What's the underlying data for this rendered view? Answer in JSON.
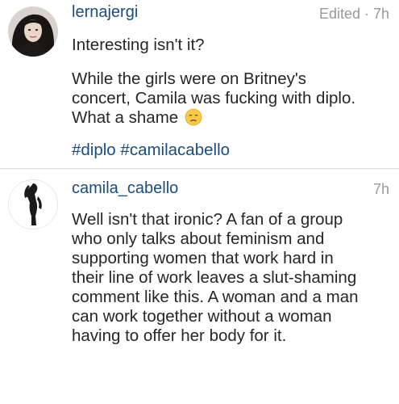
{
  "comments": [
    {
      "username": "lernajergi",
      "meta": "Edited · 7h",
      "paragraph_1": "Interesting isn't it?",
      "paragraph_2_lines": [
        "While the girls were on Britney's",
        "concert, Camila was fucking with diplo.",
        "What a shame"
      ],
      "emoji": "disappointed-face-icon",
      "hashtags": [
        "#diplo",
        "#camilacabello"
      ]
    },
    {
      "username": "camila_cabello",
      "meta": "7h",
      "body_lines": [
        "Well isn't that ironic? A fan of a group",
        "who only talks about feminism and",
        "supporting women that work hard in",
        "their line of work leaves a slut-shaming",
        "comment like this. A woman and a man",
        "can work together without a woman",
        "having to offer her body for it."
      ]
    }
  ],
  "colors": {
    "link": "#1a4d7c",
    "text": "#262626",
    "meta": "#999999",
    "emoji": "#f7c948"
  }
}
